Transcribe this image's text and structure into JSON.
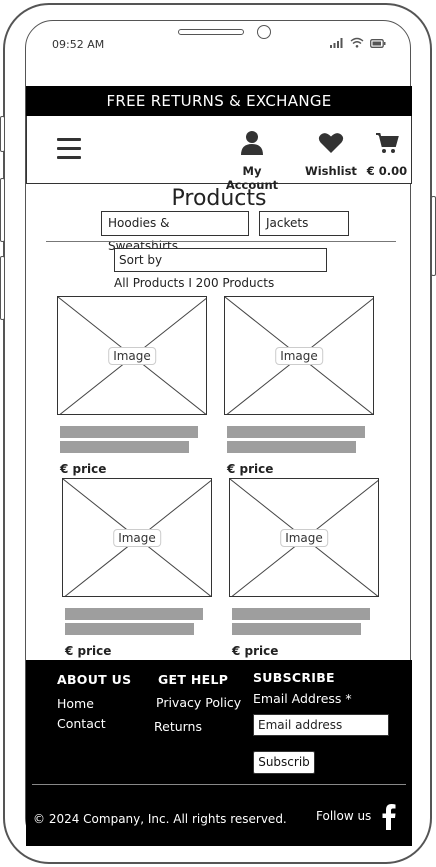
{
  "status_bar": {
    "time": "09:52 AM"
  },
  "promo": {
    "text": "FREE RETURNS & EXCHANGE"
  },
  "header": {
    "account_label": "My Account",
    "wishlist_label": "Wishlist",
    "cart_total": "€ 0.00"
  },
  "page": {
    "title": "Products",
    "categories": [
      "Hoodies & Sweatshirts",
      "Jackets"
    ],
    "sort_label": "Sort by",
    "count_text": "All Products I 200 Products"
  },
  "products": [
    {
      "image_label": "Image",
      "price": "€ price"
    },
    {
      "image_label": "Image",
      "price": "€ price"
    },
    {
      "image_label": "Image",
      "price": "€ price"
    },
    {
      "image_label": "Image",
      "price": "€ price"
    }
  ],
  "footer": {
    "about": {
      "heading": "ABOUT US",
      "links": [
        "Home",
        "Contact"
      ]
    },
    "help": {
      "heading": "GET HELP",
      "links": [
        "Privacy Policy",
        "Returns"
      ]
    },
    "subscribe": {
      "heading": "SUBSCRIBE",
      "email_label": "Email Address *",
      "email_placeholder": "Email address",
      "button_label": "Subscrib"
    },
    "copyright": "© 2024 Company, Inc. All rights reserved.",
    "follow_label": "Follow us"
  },
  "icons": {
    "menu": "hamburger-icon",
    "account": "user-icon",
    "wishlist": "heart-icon",
    "cart": "cart-icon",
    "social": "facebook-icon"
  }
}
